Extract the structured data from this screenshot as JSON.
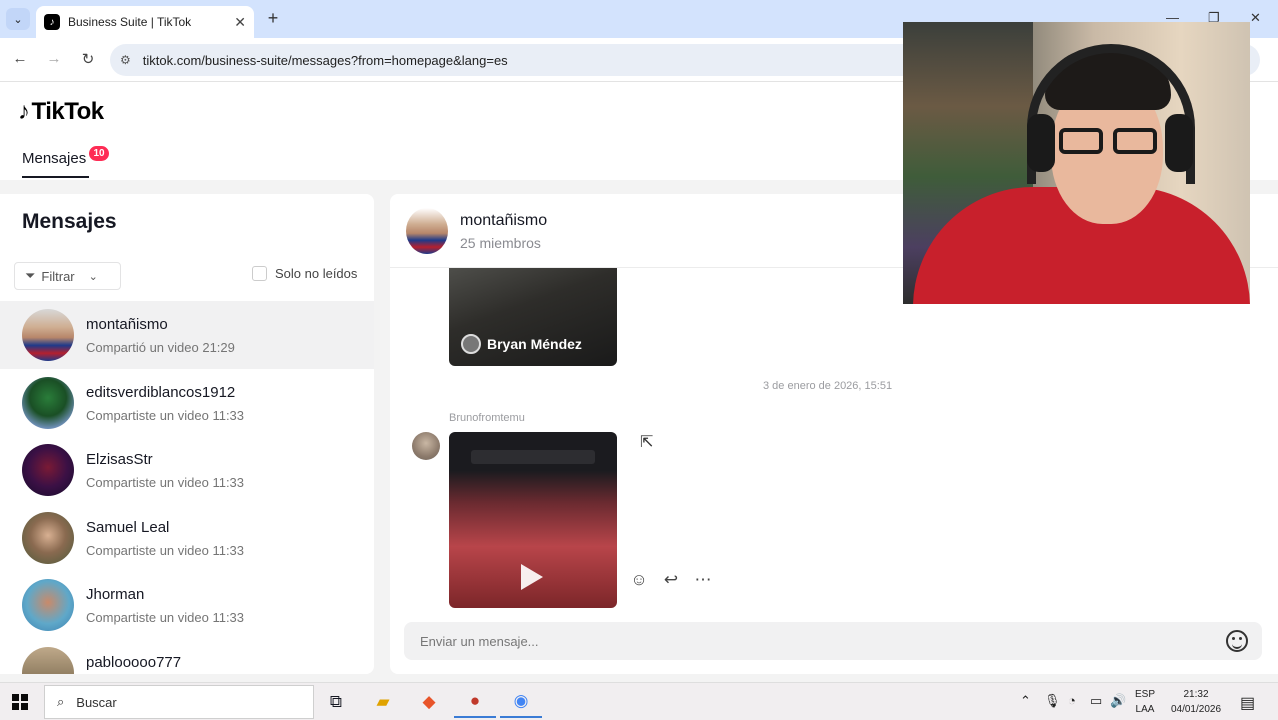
{
  "browser": {
    "tab_title": "Business Suite | TikTok",
    "tab_close": "✕",
    "new_tab": "+",
    "url": "tiktok.com/business-suite/messages?from=homepage&lang=es"
  },
  "header": {
    "logo_text": "TikTok",
    "tab_label": "Mensajes",
    "tab_badge": "10"
  },
  "inbox": {
    "title": "Mensajes",
    "filter_label": "Filtrar",
    "unread_label": "Solo no leídos",
    "conversations": [
      {
        "name": "montañismo",
        "preview": "Compartió un video 21:29",
        "active": true
      },
      {
        "name": "editsverdiblancos1912",
        "preview": "Compartiste un video 11:33"
      },
      {
        "name": "ElzisasStr",
        "preview": "Compartiste un video 11:33"
      },
      {
        "name": "Samuel Leal",
        "preview": "Compartiste un video 11:33"
      },
      {
        "name": "Jhorman",
        "preview": "Compartiste un video 11:33"
      },
      {
        "name": "pablooooo777",
        "preview": ""
      }
    ]
  },
  "chat": {
    "title": "montañismo",
    "members": "25 miembros",
    "shared_video_author": "Bryan Méndez",
    "date_separator": "3 de enero de 2026, 15:51",
    "sender": "Brunofromtemu",
    "composer_placeholder": "Enviar un mensaje..."
  },
  "taskbar": {
    "search_placeholder": "Buscar",
    "lang_line1": "ESP",
    "lang_line2": "LAA",
    "time": "21:32",
    "date": "04/01/2026"
  },
  "colors": {
    "accent": "#fe2c55",
    "chrome_tabbar": "#d3e3fd"
  }
}
